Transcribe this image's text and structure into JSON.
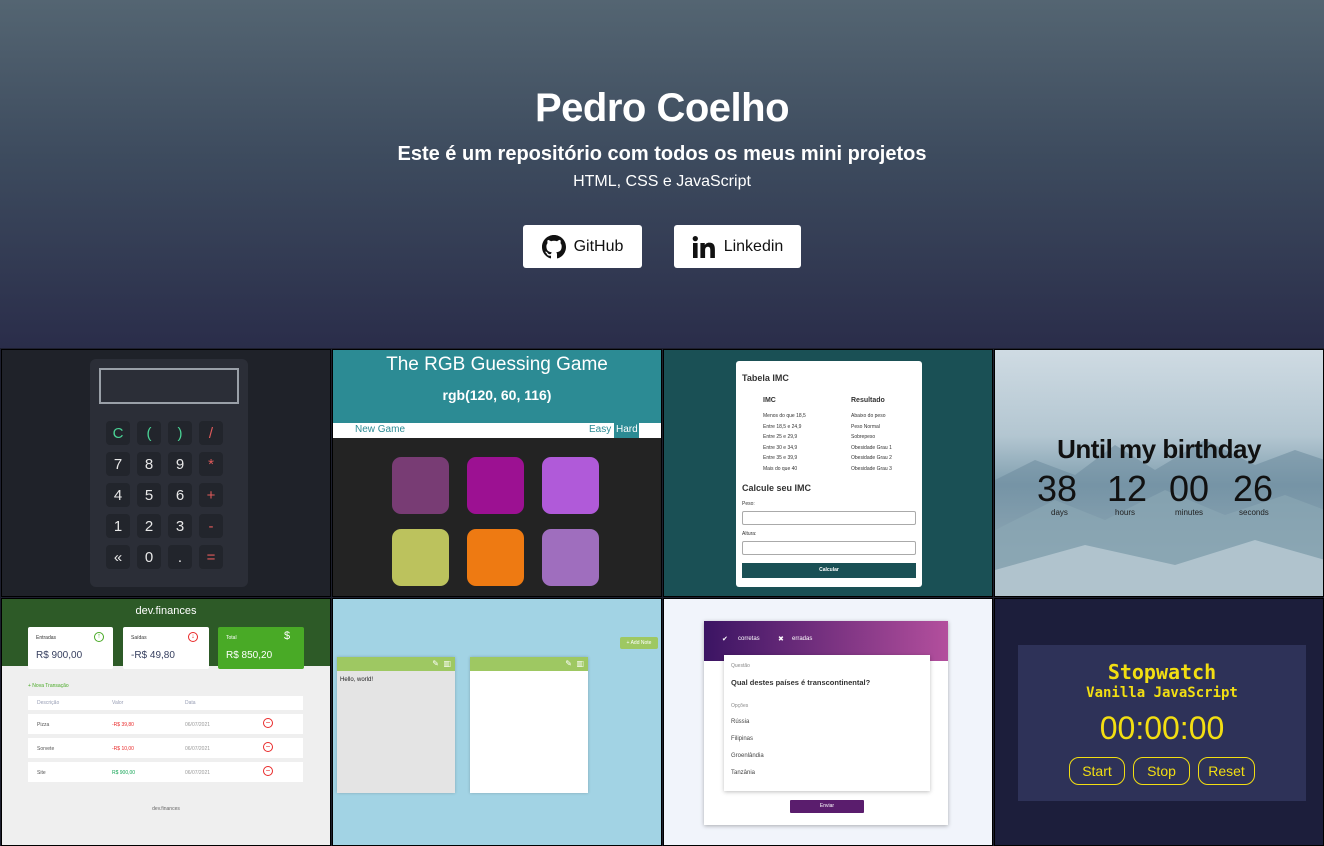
{
  "hero": {
    "title": "Pedro Coelho",
    "subtitle": "Este é um repositório com todos os meus mini projetos",
    "tech": "HTML, CSS e JavaScript",
    "github_label": "GitHub",
    "linkedin_label": "Linkedin"
  },
  "calculator": {
    "keys": [
      [
        "C",
        "(",
        ")",
        "/"
      ],
      [
        "7",
        "8",
        "9",
        "*"
      ],
      [
        "4",
        "5",
        "6",
        "+"
      ],
      [
        "1",
        "2",
        "3",
        "-"
      ],
      [
        "«",
        "0",
        ".",
        "="
      ]
    ]
  },
  "rgb": {
    "title": "The RGB Guessing Game",
    "color": "rgb(120, 60, 116)",
    "new_game": "New Game",
    "easy": "Easy",
    "hard": "Hard",
    "squares": [
      "#783c74",
      "#9c1192",
      "#b05ad9",
      "#bcc25d",
      "#ee7a12",
      "#9f6ebe"
    ]
  },
  "imc": {
    "table_title": "Tabela IMC",
    "col_imc": "IMC",
    "col_result": "Resultado",
    "rows": [
      [
        "Menos do que 18,5",
        "Abaixo do peso"
      ],
      [
        "Entre 18,5 e 24,9",
        "Peso Normal"
      ],
      [
        "Entre 25 e 29,9",
        "Sobrepeso"
      ],
      [
        "Entre 30 e 34,9",
        "Obesidade Grau 1"
      ],
      [
        "Entre 35 e 39,9",
        "Obesidade Grau 2"
      ],
      [
        "Mais do que 40",
        "Obesidade Grau 3"
      ]
    ],
    "calc_title": "Calcule seu IMC",
    "peso_label": "Peso:",
    "altura_label": "Altura:",
    "button": "Calcular"
  },
  "birthday": {
    "title": "Until my birthday",
    "days": "38",
    "hours": "12",
    "minutes": "00",
    "seconds": "26",
    "days_label": "days",
    "hours_label": "hours",
    "minutes_label": "minutes",
    "seconds_label": "seconds"
  },
  "finances": {
    "brand": "dev.finances",
    "cards": [
      {
        "label": "Entradas",
        "value": "R$ 900,00"
      },
      {
        "label": "Saídas",
        "value": "-R$ 49,80"
      },
      {
        "label": "Total",
        "value": "R$ 850,20"
      }
    ],
    "new_transaction": "+ Nova Transação",
    "headers": [
      "Descrição",
      "Valor",
      "Data"
    ],
    "rows": [
      {
        "desc": "Pizza",
        "value": "-R$ 39,80",
        "date": "06/07/2021"
      },
      {
        "desc": "Sorvete",
        "value": "-R$ 10,00",
        "date": "06/07/2021"
      },
      {
        "desc": "Site",
        "value": "R$ 900,00",
        "date": "06/07/2021"
      }
    ],
    "footer": "dev.finances"
  },
  "notes": {
    "add_label": "+ Add Note",
    "note1": "Hello, world!"
  },
  "quiz": {
    "correct_label": "corretas",
    "wrong_label": "erradas",
    "question_label": "Questão",
    "question": "Qual destes países é transcontinental?",
    "options_label": "Opções",
    "options": [
      "Rússia",
      "Filipinas",
      "Groenlândia",
      "Tanzânia"
    ],
    "submit": "Enviar"
  },
  "stopwatch": {
    "title": "Stopwatch",
    "subtitle": "Vanilla JavaScript",
    "time": "00:00:00",
    "start": "Start",
    "stop": "Stop",
    "reset": "Reset"
  }
}
